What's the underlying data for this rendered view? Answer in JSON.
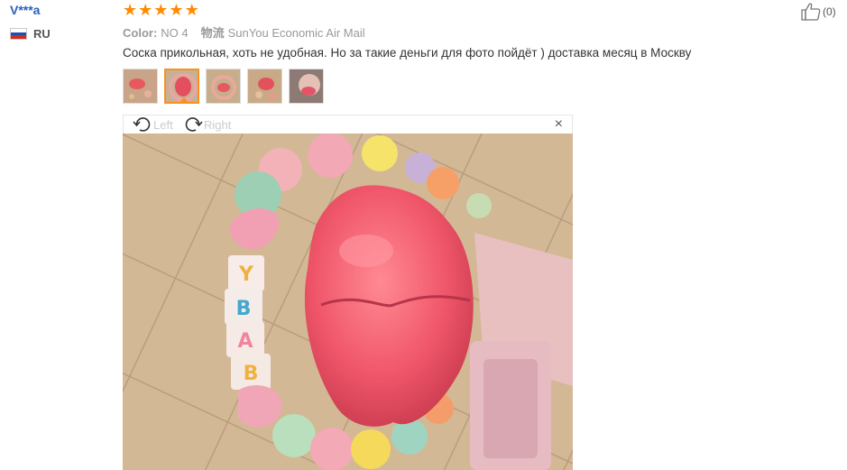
{
  "reviewer": {
    "name": "V***a",
    "country": "RU"
  },
  "rating": {
    "stars": 5
  },
  "attributes": {
    "color_label": "Color:",
    "color_value": "NO 4",
    "shipping_label": "物流",
    "shipping_value": "SunYou Economic Air Mail"
  },
  "review_text": "Соска прикольная, хоть не удобная. Но за такие деньги для фото пойдёт ) доставка месяц в Москву",
  "helpful": {
    "count": "(0)"
  },
  "thumbnails": {
    "count": 5,
    "selected_index": 1
  },
  "viewer": {
    "rotate_left": "Left",
    "rotate_right": "Right",
    "close": "×"
  },
  "icons": {
    "like": "thumbs-up-icon",
    "rotate_left": "rotate-left-icon",
    "rotate_right": "rotate-right-icon",
    "close": "close-icon"
  },
  "colors": {
    "star": "#ff8a00",
    "name": "#2a5fb8",
    "selected": "#f79122"
  }
}
